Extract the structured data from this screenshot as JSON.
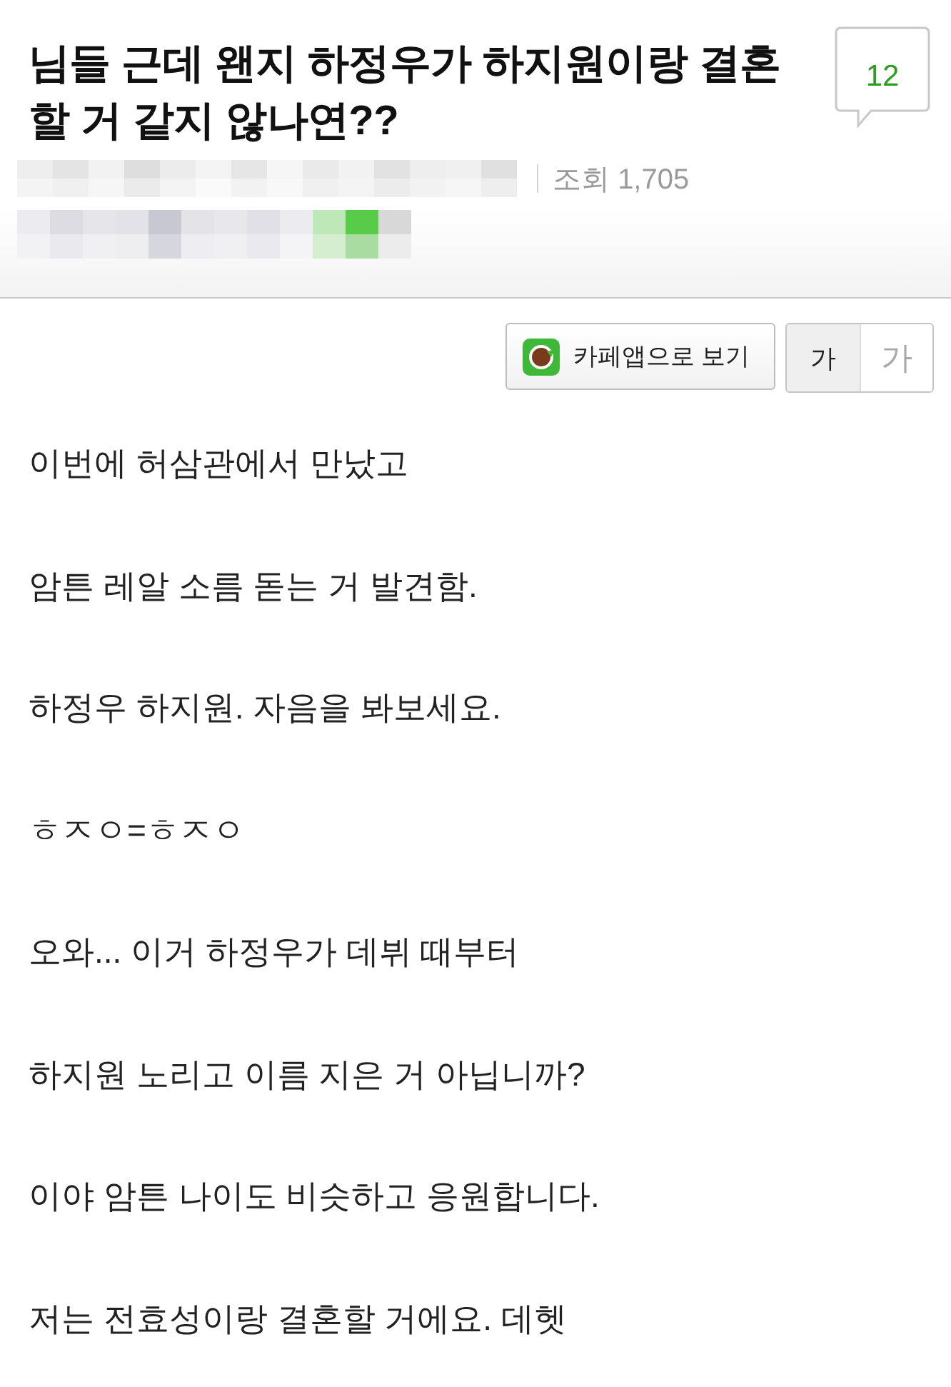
{
  "post": {
    "title_lines": [
      "님들 근데 왠지 하정우가 하지원이랑 결혼",
      "할 거 같지 않나연??"
    ],
    "comment_count": "12",
    "views_label": "조회",
    "views": "1,705"
  },
  "toolbar": {
    "app_button": "카페앱으로 보기",
    "font_sizes": [
      {
        "label": "가",
        "selected": true
      },
      {
        "label": "가",
        "selected": false
      }
    ]
  },
  "body": [
    "이번에 허삼관에서 만났고",
    "암튼 레알 소름 돋는 거 발견함.",
    "하정우 하지원. 자음을 봐보세요.",
    "ㅎㅈㅇ=ㅎㅈㅇ",
    "오와... 이거 하정우가 데뷔 때부터",
    "하지원 노리고 이름 지은 거 아닙니까?",
    "이야 암튼 나이도 비슷하고 응원합니다.",
    "저는 전효성이랑 결혼할 거에요. 데헷"
  ]
}
